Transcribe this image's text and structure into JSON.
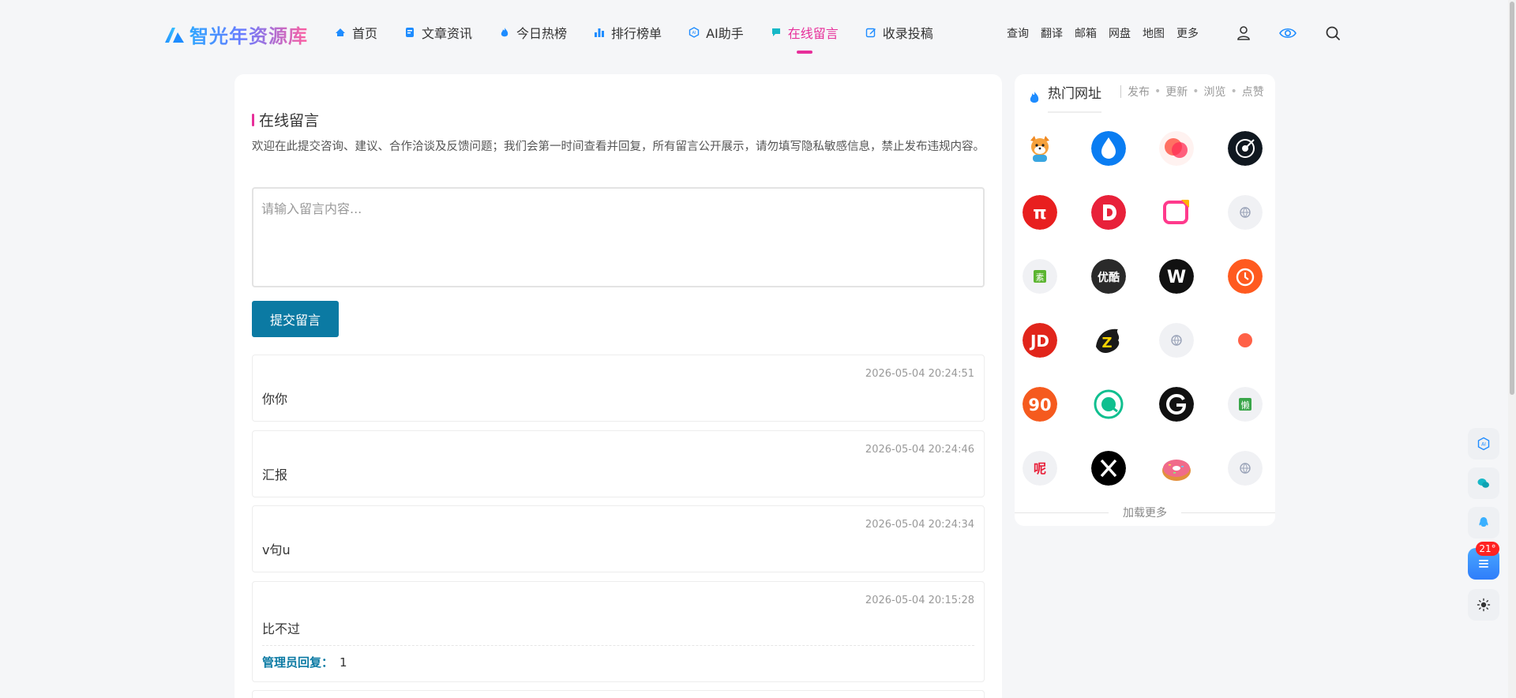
{
  "brand": {
    "name": "智光年资源库"
  },
  "nav": {
    "items": [
      {
        "label": "首页"
      },
      {
        "label": "文章资讯"
      },
      {
        "label": "今日热榜"
      },
      {
        "label": "排行榜单"
      },
      {
        "label": "AI助手"
      },
      {
        "label": "在线留言"
      },
      {
        "label": "收录投稿"
      }
    ],
    "active": "在线留言"
  },
  "quick_links": [
    "查询",
    "翻译",
    "邮箱",
    "网盘",
    "地图",
    "更多"
  ],
  "colors": {
    "accent": "#e72f9a",
    "primary": "#0b7aa3",
    "icon_blue": "#1e8cff"
  },
  "guestbook": {
    "title": "在线留言",
    "description": "欢迎在此提交咨询、建议、合作洽谈及反馈问题；我们会第一时间查看并回复，所有留言公开展示，请勿填写隐私敏感信息，禁止发布违规内容。",
    "input_value": "",
    "input_placeholder": "请输入留言内容...",
    "submit_label": "提交留言",
    "reply_label": "管理员回复：",
    "messages": [
      {
        "time": "2026-05-04 20:24:51",
        "content": "你你"
      },
      {
        "time": "2026-05-04 20:24:46",
        "content": "汇报"
      },
      {
        "time": "2026-05-04 20:24:34",
        "content": "v句u"
      },
      {
        "time": "2026-05-04 20:15:28",
        "content": "比不过",
        "reply": "1"
      }
    ]
  },
  "hot_sites": {
    "title": "热门网址",
    "tabs": [
      "发布",
      "更新",
      "浏览",
      "点赞"
    ],
    "load_more": "加载更多",
    "icons": [
      "shiba-mascot-icon",
      "water-drop-icon",
      "red-orbs-icon",
      "target-arrow-icon",
      "pi-icon",
      "d-letter-icon",
      "note-card-icon",
      "globe-placeholder-icon",
      "green-seal-icon",
      "youku-icon",
      "w-letter-icon",
      "clock-icon",
      "jd-icon",
      "z-beast-icon",
      "globe-placeholder-icon",
      "red-dot-icon",
      "ninety-icon",
      "green-circle-icon",
      "g-letter-icon",
      "lazy-char-icon",
      "ni-char-icon",
      "x-letter-icon",
      "donut-icon",
      "globe-placeholder-icon"
    ]
  },
  "float_toolbar": {
    "weather_badge": "21°"
  }
}
